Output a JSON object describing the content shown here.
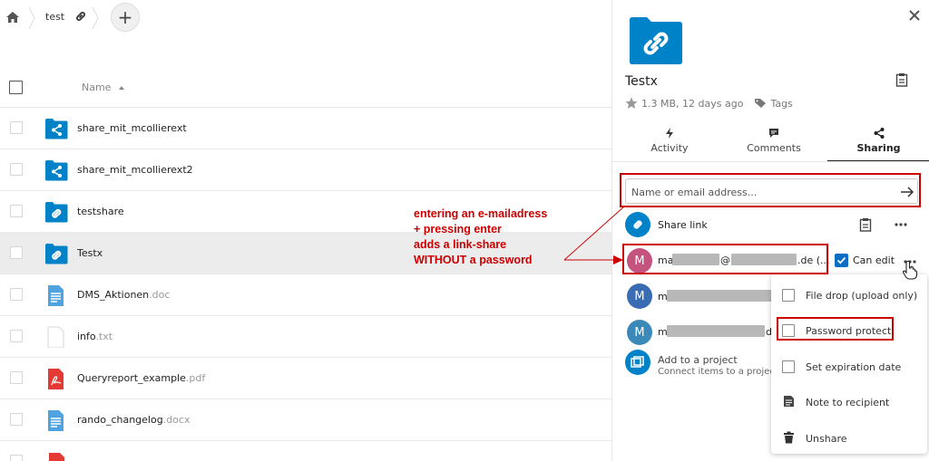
{
  "breadcrumb": {
    "folder": "test"
  },
  "file_list": {
    "column_name": "Name",
    "files": [
      {
        "name": "share_mit_mcollierext",
        "ext": "",
        "type": "shared-folder"
      },
      {
        "name": "share_mit_mcollierext2",
        "ext": "",
        "type": "shared-folder"
      },
      {
        "name": "testshare",
        "ext": "",
        "type": "link-folder"
      },
      {
        "name": "Testx",
        "ext": "",
        "type": "link-folder",
        "selected": true
      },
      {
        "name": "DMS_Aktionen",
        "ext": ".doc",
        "type": "doc"
      },
      {
        "name": "info",
        "ext": ".txt",
        "type": "txt"
      },
      {
        "name": "Queryreport_example",
        "ext": ".pdf",
        "type": "pdf"
      },
      {
        "name": "rando_changelog",
        "ext": ".docx",
        "type": "doc"
      }
    ]
  },
  "annotation": {
    "lines": [
      "entering an e-mailadress",
      "+ pressing enter",
      "adds a link-share",
      "WITHOUT a password"
    ],
    "color": "#cc0000"
  },
  "sidebar": {
    "title": "Testx",
    "meta": "1.3 MB, 12 days ago",
    "tags_label": "Tags",
    "tabs": [
      {
        "label": "Activity",
        "icon": "flash-icon"
      },
      {
        "label": "Comments",
        "icon": "comment-icon"
      },
      {
        "label": "Sharing",
        "icon": "share-icon",
        "active": true
      }
    ],
    "share_input_placeholder": "Name or email address...",
    "share_link_label": "Share link",
    "shares": [
      {
        "initial": "M",
        "name_start": "ma",
        "name_mid": "@",
        "name_end": ".de (...",
        "color": "#c4547d"
      },
      {
        "initial": "M",
        "name_start": "m",
        "color": "#3a6cb4"
      },
      {
        "initial": "M",
        "name_start": "m",
        "name_end": "de",
        "color": "#3b89b9"
      }
    ],
    "can_edit_label": "Can edit",
    "project_title": "Add to a project",
    "project_sub": "Connect items to a project t"
  },
  "share_menu": {
    "items": [
      {
        "label": "File drop (upload only)",
        "kind": "checkbox"
      },
      {
        "label": "Password protect",
        "kind": "checkbox",
        "highlighted": true
      },
      {
        "label": "Set expiration date",
        "kind": "checkbox"
      },
      {
        "label": "Note to recipient",
        "kind": "icon",
        "icon": "note-icon"
      },
      {
        "label": "Unshare",
        "kind": "icon",
        "icon": "trash-icon"
      }
    ]
  },
  "colors": {
    "accent": "#0082c9",
    "highlight": "#cc0000"
  }
}
